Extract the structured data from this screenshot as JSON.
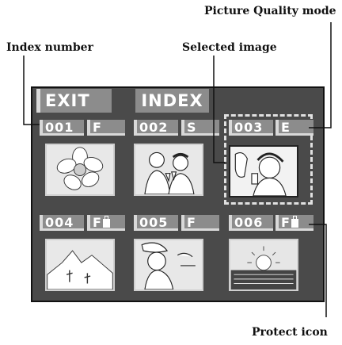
{
  "callouts": {
    "picture_quality_mode": "Picture Quality mode",
    "index_number": "Index number",
    "selected_image": "Selected image",
    "protect_icon": "Protect icon"
  },
  "screen": {
    "exit_label": "EXIT",
    "title": "INDEX",
    "cells": [
      {
        "number": "001",
        "quality": "F",
        "protected": false,
        "image": "flower"
      },
      {
        "number": "002",
        "quality": "S",
        "protected": false,
        "image": "couple-toast"
      },
      {
        "number": "003",
        "quality": "E",
        "protected": false,
        "image": "woman-phone",
        "selected": true
      },
      {
        "number": "004",
        "quality": "F",
        "protected": true,
        "image": "mountains"
      },
      {
        "number": "005",
        "quality": "F",
        "protected": false,
        "image": "woman-hat"
      },
      {
        "number": "006",
        "quality": "F",
        "protected": true,
        "image": "sunset-sea"
      }
    ]
  },
  "colors": {
    "screen_bg": "#4a4a4a",
    "badge_bg": "#8c8c8c",
    "badge_accent": "#d9d9d9",
    "text": "#ffffff"
  }
}
